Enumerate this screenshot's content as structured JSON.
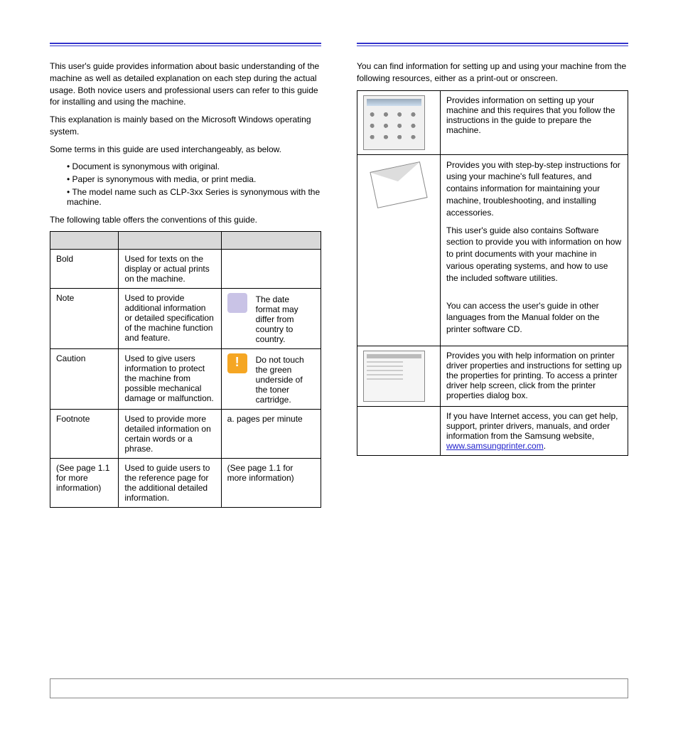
{
  "left": {
    "p1": "This user's guide provides information about basic understanding of the machine as well as detailed explanation on each step during the actual usage. Both novice users and professional users can refer to this guide for installing and using the machine.",
    "p2": "This explanation is mainly based on the Microsoft Windows operating system.",
    "p3": "Some terms in this guide are used interchangeably, as below.",
    "bullets": [
      "• Document is synonymous with original.",
      "• Paper is synonymous with media, or print media.",
      "• The model name such as CLP-3xx Series is synonymous with the machine."
    ],
    "p4": "The following table offers the conventions of this guide.",
    "table": {
      "rows": [
        {
          "c1": "Bold",
          "c2": "Used for texts on the display or actual prints on the machine.",
          "c3": ""
        },
        {
          "c1": "Note",
          "c2": "Used to provide additional information or detailed specification of the machine function and feature.",
          "c3": "The date format may differ from country to country.",
          "icon": "note"
        },
        {
          "c1": "Caution",
          "c2": "Used to give users information to protect the machine from possible mechanical damage or malfunction.",
          "c3": "Do not touch the green underside of the toner cartridge.",
          "icon": "caution"
        },
        {
          "c1": "Footnote",
          "c2": "Used to provide more detailed information on certain words or a phrase.",
          "c3": "a. pages per minute"
        },
        {
          "c1": "(See page 1.1 for more information)",
          "c2": "Used to guide users to the reference page for the additional detailed information.",
          "c3": "(See page 1.1 for more information)"
        }
      ]
    }
  },
  "right": {
    "p1": "You can find information for setting up and using your machine from the following resources, either as a print-out or onscreen.",
    "table": {
      "rows": [
        {
          "thumb": "install",
          "text": "Provides information on setting up your machine and this requires that you follow the instructions in the guide to prepare the machine."
        },
        {
          "thumb": "envelope",
          "text1": "Provides you with step-by-step instructions for using your machine's full features, and contains information for maintaining your machine, troubleshooting, and installing accessories.",
          "text2": "This user's guide also contains Software section to provide you with information on how to print documents with your machine in various operating systems, and how to use the included software utilities.",
          "text3": "You can access the user's guide in other languages from the Manual folder on the printer software CD."
        },
        {
          "thumb": "driver",
          "text1": "Provides you with help information on printer driver properties and instructions for setting up the properties for printing. To access a printer driver help screen, click ",
          "text2": " from the printer properties dialog box."
        },
        {
          "thumb": "none",
          "text1": "If you have Internet access, you can get help, support, printer drivers, manuals, and order information from the Samsung website, ",
          "link": "www.samsungprinter.com",
          "text2": "."
        }
      ]
    }
  }
}
